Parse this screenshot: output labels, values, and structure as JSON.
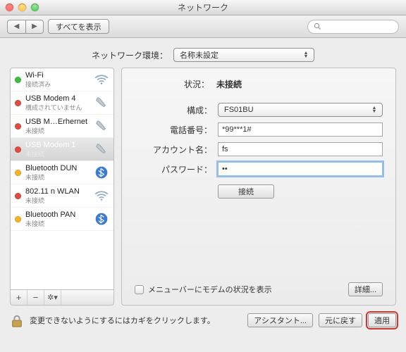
{
  "window": {
    "title": "ネットワーク"
  },
  "toolbar": {
    "show_all": "すべてを表示"
  },
  "env": {
    "label": "ネットワーク環境：",
    "value": "名称未設定"
  },
  "sidebar": {
    "items": [
      {
        "name": "Wi-Fi",
        "status": "接続済み",
        "dot": "g",
        "icon": "wifi"
      },
      {
        "name": "USB Modem 4",
        "status": "構成されていません",
        "dot": "r",
        "icon": "phone"
      },
      {
        "name": "USB M…Erhernet",
        "status": "未接続",
        "dot": "r",
        "icon": "phone"
      },
      {
        "name": "USB Modem 1",
        "status": "未接続",
        "dot": "r",
        "icon": "phone",
        "selected": true
      },
      {
        "name": "Bluetooth DUN",
        "status": "未接続",
        "dot": "y",
        "icon": "bt"
      },
      {
        "name": "802.11 n WLAN",
        "status": "未接続",
        "dot": "r",
        "icon": "wifi"
      },
      {
        "name": "Bluetooth PAN",
        "status": "未接続",
        "dot": "y",
        "icon": "bt"
      }
    ]
  },
  "detail": {
    "status_label": "状況：",
    "status_value": "未接続",
    "config_label": "構成：",
    "config_value": "FS01BU",
    "phone_label": "電話番号：",
    "phone_value": "*99***1#",
    "account_label": "アカウント名：",
    "account_value": "fs",
    "password_label": "パスワード：",
    "password_value": "••",
    "connect": "接続",
    "menubar_checkbox": "メニューバーにモデムの状況を表示",
    "advanced": "詳細..."
  },
  "footer": {
    "lock_text": "変更できないようにするにはカギをクリックします。",
    "assistant": "アシスタント...",
    "revert": "元に戻す",
    "apply": "適用"
  }
}
